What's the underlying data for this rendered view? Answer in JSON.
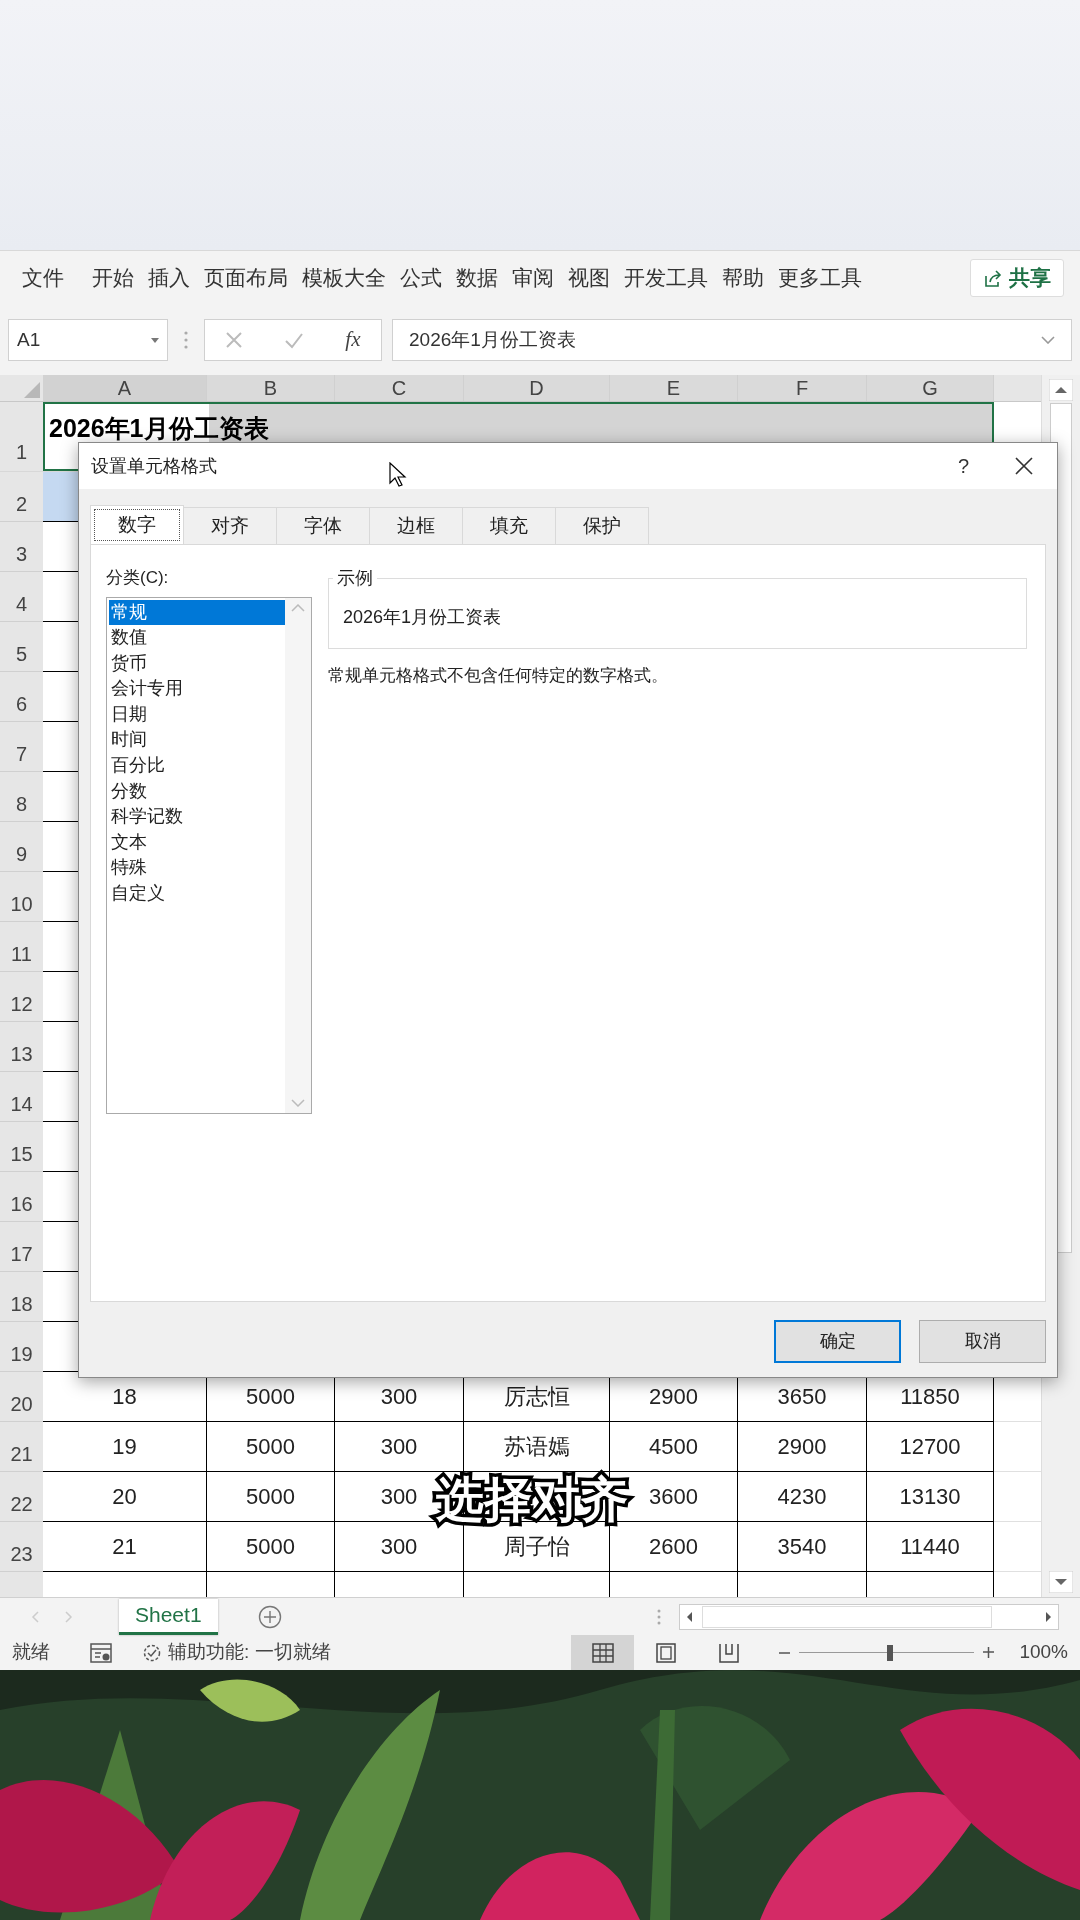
{
  "menu_bar": {
    "items": [
      "文件",
      "开始",
      "插入",
      "页面布局",
      "模板大全",
      "公式",
      "数据",
      "审阅",
      "视图",
      "开发工具",
      "帮助",
      "更多工具"
    ],
    "share_button": "共享"
  },
  "formula_bar": {
    "name_box": "A1",
    "function_label": "fx",
    "formula": "2026年1月份工资表"
  },
  "sheet": {
    "columns": [
      "A",
      "B",
      "C",
      "D",
      "E",
      "F",
      "G"
    ],
    "row_numbers": [
      "1",
      "2",
      "3",
      "4",
      "5",
      "6",
      "7",
      "8",
      "9",
      "10",
      "11",
      "12",
      "13",
      "14",
      "15",
      "16",
      "17",
      "18",
      "19"
    ],
    "title_cell": "2026年1月份工资表",
    "rows": [
      {
        "number": "20",
        "cells": [
          "18",
          "5000",
          "300",
          "厉志恒",
          "2900",
          "3650",
          "11850"
        ]
      },
      {
        "number": "21",
        "cells": [
          "19",
          "5000",
          "300",
          "苏语嫣",
          "4500",
          "2900",
          "12700"
        ]
      },
      {
        "number": "22",
        "cells": [
          "20",
          "5000",
          "300",
          "",
          "3600",
          "4230",
          "13130"
        ]
      },
      {
        "number": "23",
        "cells": [
          "21",
          "5000",
          "300",
          "周子怡",
          "2600",
          "3540",
          "11440"
        ]
      }
    ]
  },
  "dialog": {
    "title": "设置单元格格式",
    "help": "?",
    "tabs": [
      {
        "label": "数字",
        "selected": true
      },
      {
        "label": "对齐",
        "selected": false
      },
      {
        "label": "字体",
        "selected": false
      },
      {
        "label": "边框",
        "selected": false
      },
      {
        "label": "填充",
        "selected": false
      },
      {
        "label": "保护",
        "selected": false
      }
    ],
    "category_label": "分类(C):",
    "categories": [
      {
        "label": "常规",
        "selected": true
      },
      {
        "label": "数值",
        "selected": false
      },
      {
        "label": "货币",
        "selected": false
      },
      {
        "label": "会计专用",
        "selected": false
      },
      {
        "label": "日期",
        "selected": false
      },
      {
        "label": "时间",
        "selected": false
      },
      {
        "label": "百分比",
        "selected": false
      },
      {
        "label": "分数",
        "selected": false
      },
      {
        "label": "科学记数",
        "selected": false
      },
      {
        "label": "文本",
        "selected": false
      },
      {
        "label": "特殊",
        "selected": false
      },
      {
        "label": "自定义",
        "selected": false
      }
    ],
    "sample_label": "示例",
    "sample_value": "2026年1月份工资表",
    "description": "常规单元格格式不包含任何特定的数字格式。",
    "buttons": [
      {
        "label": "确定",
        "default": true
      },
      {
        "label": "取消",
        "default": false
      }
    ]
  },
  "sheet_tabs": [
    {
      "label": "Sheet1",
      "selected": true
    }
  ],
  "status_bar": {
    "status": "就绪",
    "accessibility": "辅助功能: 一切就绪",
    "views": [
      {
        "kind": "normal",
        "selected": true
      },
      {
        "kind": "page_layout",
        "selected": false
      },
      {
        "kind": "page_break",
        "selected": false
      }
    ],
    "zoom": {
      "level": 0.52,
      "reading": "100%"
    }
  },
  "caption": "选择对齐"
}
